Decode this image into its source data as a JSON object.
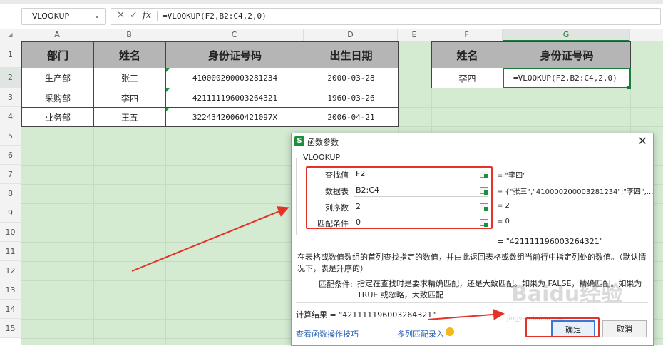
{
  "formula_bar": {
    "name_box": "VLOOKUP",
    "formula": "=VLOOKUP(F2,B2:C4,2,0)"
  },
  "columns": [
    "A",
    "B",
    "C",
    "D",
    "E",
    "F",
    "G"
  ],
  "rows": [
    "1",
    "2",
    "3",
    "4",
    "5",
    "6",
    "7",
    "8",
    "9",
    "10",
    "11",
    "12",
    "13",
    "14",
    "15"
  ],
  "table": {
    "headers": [
      "部门",
      "姓名",
      "身份证号码",
      "出生日期"
    ],
    "rows": [
      [
        "生产部",
        "张三",
        "410000200003281234",
        "2000-03-28"
      ],
      [
        "采购部",
        "李四",
        "421111196003264321",
        "1960-03-26"
      ],
      [
        "业务部",
        "王五",
        "32243420060421097X",
        "2006-04-21"
      ]
    ]
  },
  "lookup": {
    "headers": [
      "姓名",
      "身份证号码"
    ],
    "name": "李四",
    "formula": "=VLOOKUP(F2,B2:C4,2,0)"
  },
  "dialog": {
    "title": "函数参数",
    "function": "VLOOKUP",
    "args": [
      {
        "label": "查找值",
        "value": "F2",
        "result": "= \"李四\""
      },
      {
        "label": "数据表",
        "value": "B2:C4",
        "result": "= {\"张三\",\"410000200003281234\";\"李四\",..."
      },
      {
        "label": "列序数",
        "value": "2",
        "result": "= 2"
      },
      {
        "label": "匹配条件",
        "value": "0",
        "result": "= 0"
      }
    ],
    "overall_result": "= \"421111196003264321\"",
    "description": "在表格或数值数组的首列查找指定的数值，并由此返回表格或数组当前行中指定列处的数值。（默认情况下，表是升序的）",
    "param_label": "匹配条件:",
    "param_desc": "指定在查找时是要求精确匹配，还是大致匹配。如果为 FALSE，精确匹配。如果为 TRUE 或忽略，大致匹配",
    "calc_result": "计算结果 = \"421111196003264321\"",
    "link_tips": "查看函数操作技巧",
    "link_multi": "多列匹配录入",
    "ok": "确定",
    "cancel": "取消"
  },
  "watermark": {
    "main": "Baidu经验",
    "sub": "jingyan.baidu.com"
  },
  "colors": {
    "green_fill": "#d4ebd2",
    "header_gray": "#b5b5b5",
    "accent": "#1b7a3e",
    "annotation_red": "#e53228"
  }
}
